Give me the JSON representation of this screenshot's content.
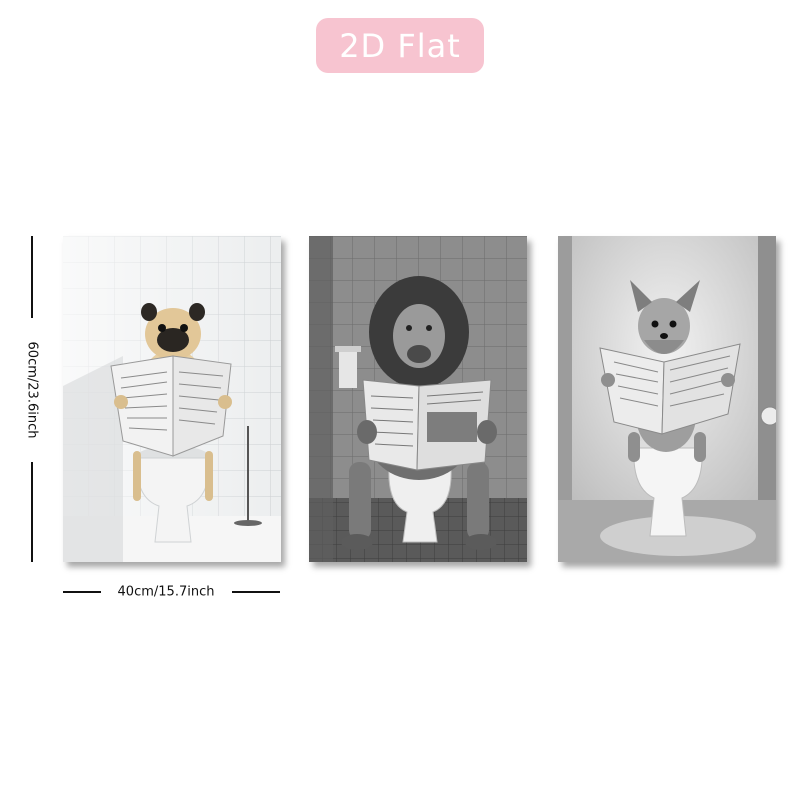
{
  "badge": {
    "label": "2D Flat",
    "color": "#f7c4d0"
  },
  "dimensions": {
    "height_label": "60cm/23.6inch",
    "width_label": "40cm/15.7inch"
  },
  "panels": [
    {
      "subject": "pug-reading-newspaper-on-toilet",
      "tone": "color"
    },
    {
      "subject": "lion-reading-newspaper-on-toilet",
      "tone": "grayscale"
    },
    {
      "subject": "yorkshire-terrier-reading-newspaper-on-toilet",
      "tone": "grayscale"
    }
  ]
}
